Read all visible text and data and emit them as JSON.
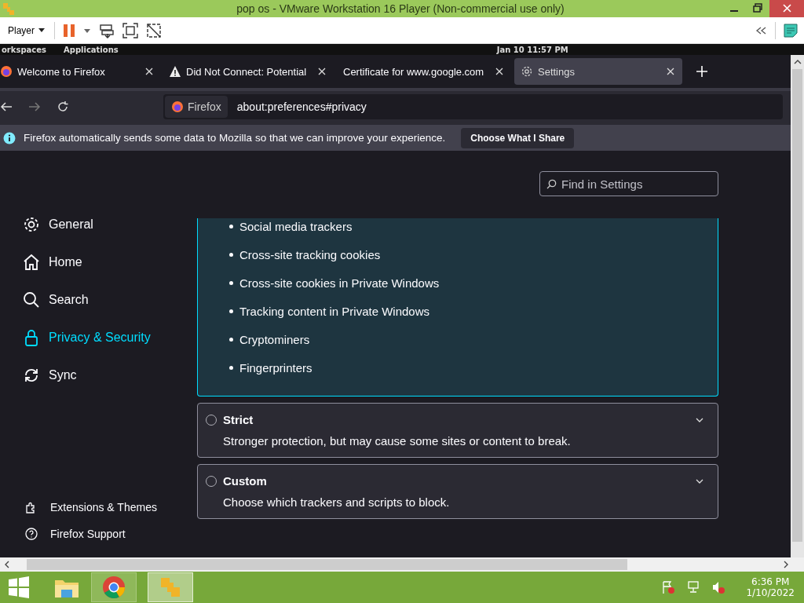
{
  "vm_window": {
    "title": "pop os - VMware Workstation 16 Player (Non-commercial use only)",
    "player_menu": "Player"
  },
  "guest_topbar": {
    "items": [
      "orkspaces",
      "Applications"
    ],
    "clock": "Jan 10  11:57 PM"
  },
  "tabs": [
    {
      "label": "Welcome to Firefox",
      "kind": "firefox",
      "selected": false
    },
    {
      "label": "Did Not Connect: Potential",
      "kind": "warning",
      "selected": false
    },
    {
      "label": "Certificate for www.google.com",
      "kind": "plain",
      "selected": false
    },
    {
      "label": "Settings",
      "kind": "settings",
      "selected": true
    }
  ],
  "address_bar": {
    "identity": "Firefox",
    "url": "about:preferences#privacy"
  },
  "notification": {
    "text": "Firefox automatically sends some data to Mozilla so that we can improve your experience.",
    "button": "Choose What I Share"
  },
  "settings_search": {
    "placeholder": "Find in Settings"
  },
  "sidebar": {
    "items": [
      {
        "label": "General",
        "kind": "general",
        "selected": false
      },
      {
        "label": "Home",
        "kind": "home",
        "selected": false
      },
      {
        "label": "Search",
        "kind": "search",
        "selected": false
      },
      {
        "label": "Privacy & Security",
        "kind": "privacy",
        "selected": true
      },
      {
        "label": "Sync",
        "kind": "sync",
        "selected": false
      }
    ],
    "footer": [
      {
        "label": "Extensions & Themes",
        "kind": "extensions"
      },
      {
        "label": "Firefox Support",
        "kind": "support"
      }
    ]
  },
  "standard_blocked": [
    "Social media trackers",
    "Cross-site tracking cookies",
    "Cross-site cookies in Private Windows",
    "Tracking content in Private Windows",
    "Cryptominers",
    "Fingerprinters"
  ],
  "protection_options": [
    {
      "label": "Strict",
      "description": "Stronger protection, but may cause some sites or content to break.",
      "selected": false
    },
    {
      "label": "Custom",
      "description": "Choose which trackers and scripts to block.",
      "selected": false
    }
  ],
  "taskbar": {
    "time": "6:36 PM",
    "date": "1/10/2022"
  }
}
